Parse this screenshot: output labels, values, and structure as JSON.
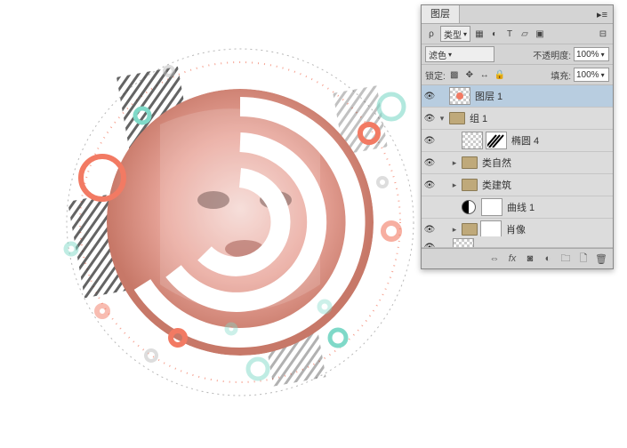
{
  "panel": {
    "title": "图层",
    "filter_label": "类型",
    "icons_tooltip": [
      "pixel",
      "adjust",
      "type",
      "shape",
      "smart"
    ],
    "blend_mode": "滤色",
    "opacity_label": "不透明度:",
    "opacity_value": "100%",
    "lock_label": "锁定:",
    "fill_label": "填充:",
    "fill_value": "100%"
  },
  "layers": [
    {
      "name": "图层 1",
      "indent": 0,
      "vis": true,
      "sel": true,
      "thumb": "checker-dot",
      "mask": false,
      "type": "layer",
      "fold": ""
    },
    {
      "name": "组 1",
      "indent": 0,
      "vis": true,
      "sel": false,
      "type": "folder",
      "fold": "open"
    },
    {
      "name": "椭圆 4",
      "indent": 1,
      "vis": true,
      "sel": false,
      "thumb": "checker",
      "mask": "stripes",
      "type": "layer",
      "fold": ""
    },
    {
      "name": "类自然",
      "indent": 1,
      "vis": true,
      "sel": false,
      "type": "folder",
      "fold": "closed"
    },
    {
      "name": "类建筑",
      "indent": 1,
      "vis": true,
      "sel": false,
      "type": "folder",
      "fold": "closed"
    },
    {
      "name": "曲线 1",
      "indent": 1,
      "vis": false,
      "sel": false,
      "thumb": "adjust",
      "mask": "white",
      "type": "adjust",
      "fold": ""
    },
    {
      "name": "肖像",
      "indent": 1,
      "vis": true,
      "sel": false,
      "type": "folder-mask",
      "fold": "closed",
      "mask": "white"
    }
  ],
  "footer_icons": [
    "link",
    "fx",
    "mask",
    "adjust",
    "group",
    "new",
    "trash"
  ],
  "search_placeholder": "ρ"
}
